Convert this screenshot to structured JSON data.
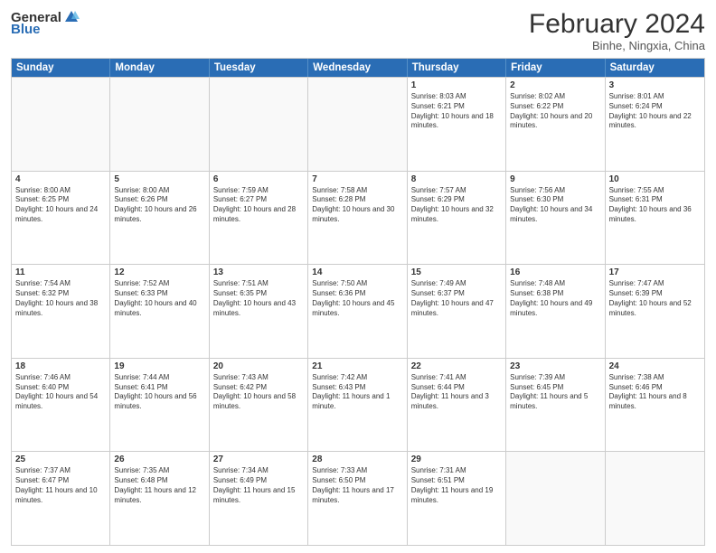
{
  "header": {
    "logo": {
      "general": "General",
      "blue": "Blue"
    },
    "title": "February 2024",
    "subtitle": "Binhe, Ningxia, China"
  },
  "days": [
    "Sunday",
    "Monday",
    "Tuesday",
    "Wednesday",
    "Thursday",
    "Friday",
    "Saturday"
  ],
  "weeks": [
    [
      {
        "day": "",
        "empty": true
      },
      {
        "day": "",
        "empty": true
      },
      {
        "day": "",
        "empty": true
      },
      {
        "day": "",
        "empty": true
      },
      {
        "day": "1",
        "sunrise": "8:03 AM",
        "sunset": "6:21 PM",
        "daylight": "10 hours and 18 minutes."
      },
      {
        "day": "2",
        "sunrise": "8:02 AM",
        "sunset": "6:22 PM",
        "daylight": "10 hours and 20 minutes."
      },
      {
        "day": "3",
        "sunrise": "8:01 AM",
        "sunset": "6:24 PM",
        "daylight": "10 hours and 22 minutes."
      }
    ],
    [
      {
        "day": "4",
        "sunrise": "8:00 AM",
        "sunset": "6:25 PM",
        "daylight": "10 hours and 24 minutes."
      },
      {
        "day": "5",
        "sunrise": "8:00 AM",
        "sunset": "6:26 PM",
        "daylight": "10 hours and 26 minutes."
      },
      {
        "day": "6",
        "sunrise": "7:59 AM",
        "sunset": "6:27 PM",
        "daylight": "10 hours and 28 minutes."
      },
      {
        "day": "7",
        "sunrise": "7:58 AM",
        "sunset": "6:28 PM",
        "daylight": "10 hours and 30 minutes."
      },
      {
        "day": "8",
        "sunrise": "7:57 AM",
        "sunset": "6:29 PM",
        "daylight": "10 hours and 32 minutes."
      },
      {
        "day": "9",
        "sunrise": "7:56 AM",
        "sunset": "6:30 PM",
        "daylight": "10 hours and 34 minutes."
      },
      {
        "day": "10",
        "sunrise": "7:55 AM",
        "sunset": "6:31 PM",
        "daylight": "10 hours and 36 minutes."
      }
    ],
    [
      {
        "day": "11",
        "sunrise": "7:54 AM",
        "sunset": "6:32 PM",
        "daylight": "10 hours and 38 minutes."
      },
      {
        "day": "12",
        "sunrise": "7:52 AM",
        "sunset": "6:33 PM",
        "daylight": "10 hours and 40 minutes."
      },
      {
        "day": "13",
        "sunrise": "7:51 AM",
        "sunset": "6:35 PM",
        "daylight": "10 hours and 43 minutes."
      },
      {
        "day": "14",
        "sunrise": "7:50 AM",
        "sunset": "6:36 PM",
        "daylight": "10 hours and 45 minutes."
      },
      {
        "day": "15",
        "sunrise": "7:49 AM",
        "sunset": "6:37 PM",
        "daylight": "10 hours and 47 minutes."
      },
      {
        "day": "16",
        "sunrise": "7:48 AM",
        "sunset": "6:38 PM",
        "daylight": "10 hours and 49 minutes."
      },
      {
        "day": "17",
        "sunrise": "7:47 AM",
        "sunset": "6:39 PM",
        "daylight": "10 hours and 52 minutes."
      }
    ],
    [
      {
        "day": "18",
        "sunrise": "7:46 AM",
        "sunset": "6:40 PM",
        "daylight": "10 hours and 54 minutes."
      },
      {
        "day": "19",
        "sunrise": "7:44 AM",
        "sunset": "6:41 PM",
        "daylight": "10 hours and 56 minutes."
      },
      {
        "day": "20",
        "sunrise": "7:43 AM",
        "sunset": "6:42 PM",
        "daylight": "10 hours and 58 minutes."
      },
      {
        "day": "21",
        "sunrise": "7:42 AM",
        "sunset": "6:43 PM",
        "daylight": "11 hours and 1 minute."
      },
      {
        "day": "22",
        "sunrise": "7:41 AM",
        "sunset": "6:44 PM",
        "daylight": "11 hours and 3 minutes."
      },
      {
        "day": "23",
        "sunrise": "7:39 AM",
        "sunset": "6:45 PM",
        "daylight": "11 hours and 5 minutes."
      },
      {
        "day": "24",
        "sunrise": "7:38 AM",
        "sunset": "6:46 PM",
        "daylight": "11 hours and 8 minutes."
      }
    ],
    [
      {
        "day": "25",
        "sunrise": "7:37 AM",
        "sunset": "6:47 PM",
        "daylight": "11 hours and 10 minutes."
      },
      {
        "day": "26",
        "sunrise": "7:35 AM",
        "sunset": "6:48 PM",
        "daylight": "11 hours and 12 minutes."
      },
      {
        "day": "27",
        "sunrise": "7:34 AM",
        "sunset": "6:49 PM",
        "daylight": "11 hours and 15 minutes."
      },
      {
        "day": "28",
        "sunrise": "7:33 AM",
        "sunset": "6:50 PM",
        "daylight": "11 hours and 17 minutes."
      },
      {
        "day": "29",
        "sunrise": "7:31 AM",
        "sunset": "6:51 PM",
        "daylight": "11 hours and 19 minutes."
      },
      {
        "day": "",
        "empty": true
      },
      {
        "day": "",
        "empty": true
      }
    ]
  ]
}
